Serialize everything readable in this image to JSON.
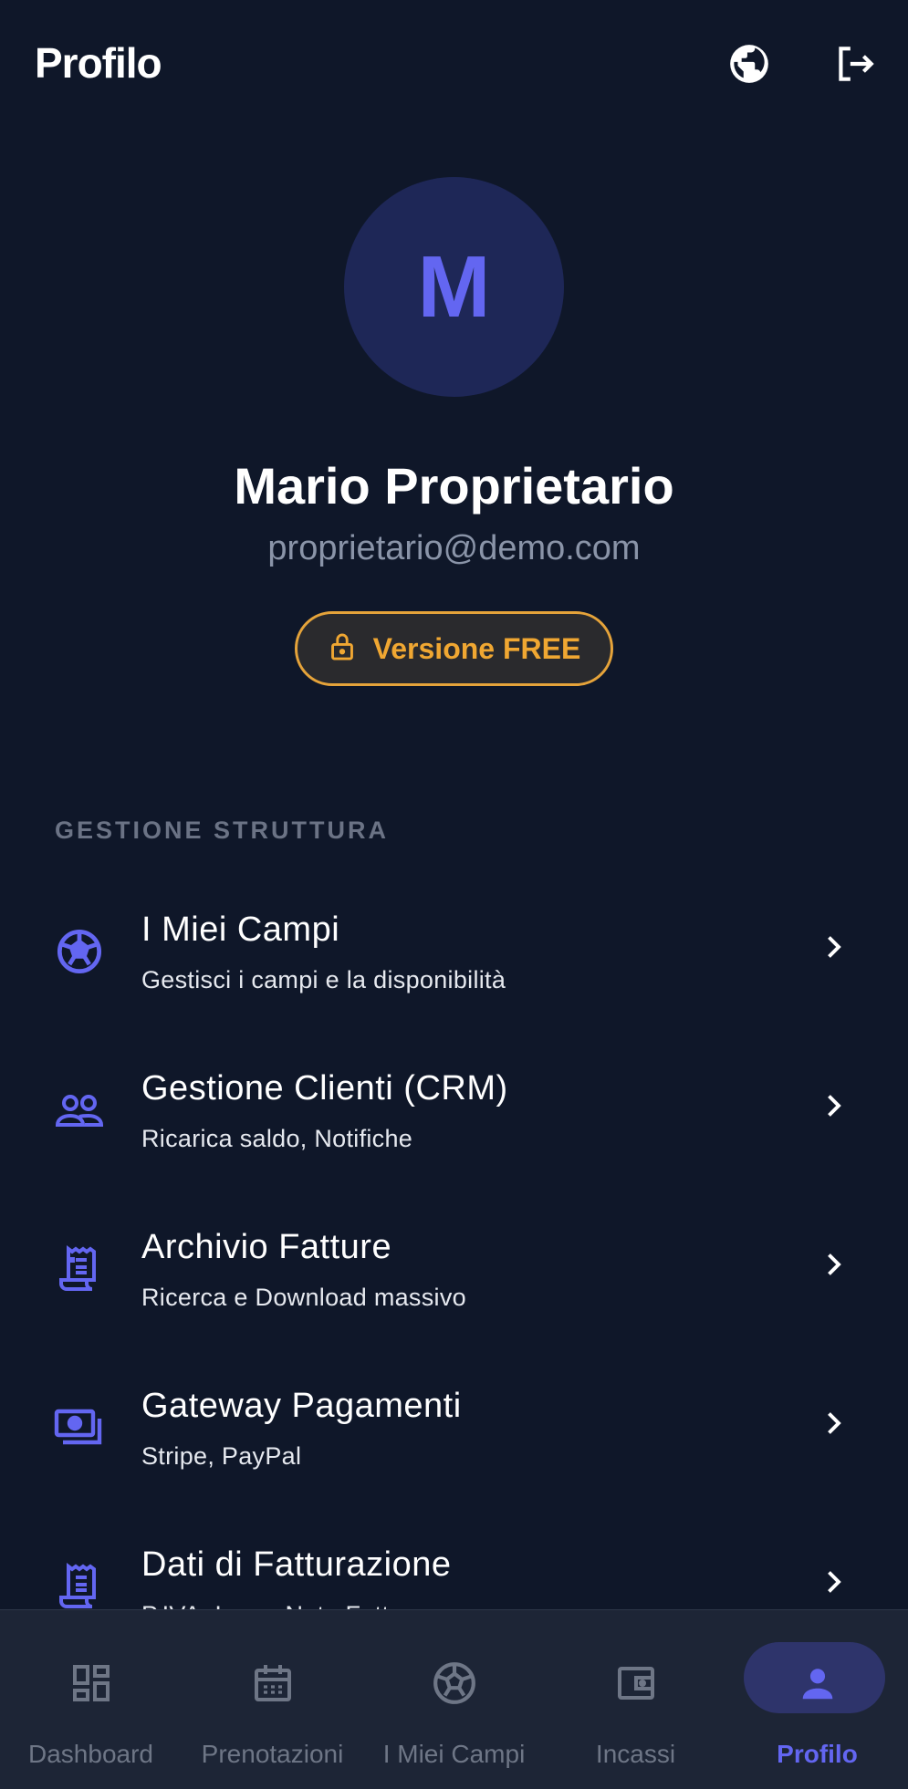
{
  "header": {
    "title": "Profilo",
    "globe_icon": "globe-icon",
    "logout_icon": "logout-icon"
  },
  "profile": {
    "initial": "M",
    "name": "Mario Proprietario",
    "email": "proprietario@demo.com",
    "plan_label": "Versione FREE",
    "plan_icon": "lock-icon"
  },
  "section": {
    "title": "GESTIONE STRUTTURA"
  },
  "menu": {
    "items": [
      {
        "title": "I Miei Campi",
        "subtitle": "Gestisci i campi e la disponibilità",
        "icon": "soccer-ball-icon"
      },
      {
        "title": "Gestione Clienti (CRM)",
        "subtitle": "Ricarica saldo, Notifiche",
        "icon": "people-icon"
      },
      {
        "title": "Archivio Fatture",
        "subtitle": "Ricerca e Download massivo",
        "icon": "receipt-icon"
      },
      {
        "title": "Gateway Pagamenti",
        "subtitle": "Stripe, PayPal",
        "icon": "payments-icon"
      },
      {
        "title": "Dati di Fatturazione",
        "subtitle": "P.IVA, Logo, Note Fattura",
        "icon": "receipt-icon"
      }
    ]
  },
  "nav": {
    "items": [
      {
        "label": "Dashboard",
        "icon": "dashboard-icon"
      },
      {
        "label": "Prenotazioni",
        "icon": "calendar-icon"
      },
      {
        "label": "I Miei Campi",
        "icon": "soccer-ball-icon"
      },
      {
        "label": "Incassi",
        "icon": "wallet-icon"
      },
      {
        "label": "Profilo",
        "icon": "person-icon"
      }
    ],
    "active": "Profilo"
  },
  "colors": {
    "background": "#0f1729",
    "accent": "#6366f1",
    "badge": "#f0a732",
    "nav_background": "#1d2536"
  }
}
